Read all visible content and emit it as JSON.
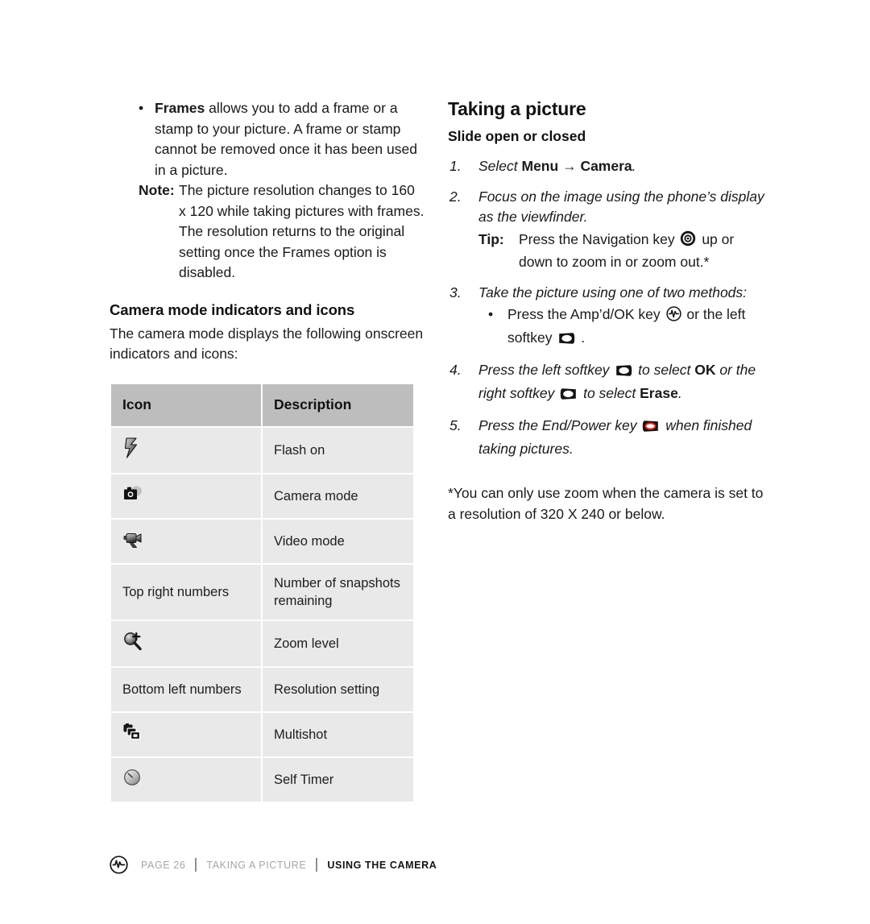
{
  "left_column": {
    "bullet": {
      "marker": "•",
      "lead": "Frames",
      "text": " allows you to add a frame or a stamp to your picture. A frame or stamp cannot be removed once it has been used in a picture."
    },
    "note": {
      "label": "Note:",
      "text": "The picture resolution changes to 160 x 120 while taking pictures with frames. The resolution returns to the original setting once the Frames option is disabled."
    },
    "section_heading": "Camera mode indicators and icons",
    "intro": "The camera mode displays the following onscreen indicators and icons:",
    "table": {
      "headers": [
        "Icon",
        "Description"
      ],
      "rows": [
        {
          "icon": "flash-on-icon",
          "icon_text": "",
          "description": "Flash on"
        },
        {
          "icon": "camera-mode-icon",
          "icon_text": "",
          "description": "Camera mode"
        },
        {
          "icon": "video-mode-icon",
          "icon_text": "",
          "description": "Video mode"
        },
        {
          "icon": "",
          "icon_text": "Top right numbers",
          "description": "Number of snapshots remaining"
        },
        {
          "icon": "zoom-level-icon",
          "icon_text": "",
          "description": "Zoom level"
        },
        {
          "icon": "",
          "icon_text": "Bottom left numbers",
          "description": "Resolution setting"
        },
        {
          "icon": "multishot-icon",
          "icon_text": "",
          "description": "Multishot"
        },
        {
          "icon": "self-timer-icon",
          "icon_text": "",
          "description": "Self Timer"
        }
      ]
    }
  },
  "right_column": {
    "title": "Taking a picture",
    "subtitle": "Slide open or closed",
    "steps": [
      {
        "number": "1.",
        "parts": [
          {
            "kind": "italic",
            "text": "Select "
          },
          {
            "kind": "bold",
            "text": "Menu"
          },
          {
            "kind": "italic",
            "text": " "
          },
          {
            "kind": "arrow",
            "text": "→"
          },
          {
            "kind": "bold",
            "text": " Camera"
          },
          {
            "kind": "italic",
            "text": "."
          }
        ]
      },
      {
        "number": "2.",
        "parts": [
          {
            "kind": "italic",
            "text": "Focus on the image using the phone’s display as the viewfinder."
          }
        ],
        "tip": {
          "label": "Tip:",
          "before": "Press the Navigation key",
          "icon": "navigation-key-icon",
          "after": "up or down to zoom in or zoom out.*"
        }
      },
      {
        "number": "3.",
        "parts": [
          {
            "kind": "italic",
            "text": "Take the picture using one of two methods:"
          }
        ],
        "sub_bullet": {
          "marker": "•",
          "before": "Press the Amp’d/OK key",
          "icon1": "ampd-ok-key-icon",
          "middle": "or the left softkey",
          "icon2": "left-softkey-icon",
          "after": "."
        }
      },
      {
        "number": "4.",
        "segments": [
          {
            "kind": "italic",
            "text": "Press the left softkey "
          },
          {
            "kind": "icon",
            "icon": "left-softkey-icon"
          },
          {
            "kind": "italic",
            "text": " to select "
          },
          {
            "kind": "bold",
            "text": "OK"
          },
          {
            "kind": "italic",
            "text": " or the right softkey "
          },
          {
            "kind": "icon",
            "icon": "right-softkey-icon"
          },
          {
            "kind": "italic",
            "text": " to select "
          },
          {
            "kind": "bold",
            "text": "Erase"
          },
          {
            "kind": "italic",
            "text": "."
          }
        ]
      },
      {
        "number": "5.",
        "segments": [
          {
            "kind": "italic",
            "text": "Press the End/Power key "
          },
          {
            "kind": "icon",
            "icon": "end-power-key-icon"
          },
          {
            "kind": "italic",
            "text": " when finished taking pictures."
          }
        ]
      }
    ],
    "footnote": "*You can only use zoom when the camera is set to a resolution of 320 X 240 or below."
  },
  "footer": {
    "logo": "ampd-logo-icon",
    "page": "PAGE 26",
    "crumb1": "TAKING A PICTURE",
    "crumb2": "USING THE CAMERA"
  },
  "colors": {
    "table_header_bg": "#bdbdbd",
    "table_cell_bg": "#e9e9e9",
    "text": "#1d1d1d",
    "footer_muted": "#a6a6a6",
    "end_key_red": "#e2231a"
  }
}
